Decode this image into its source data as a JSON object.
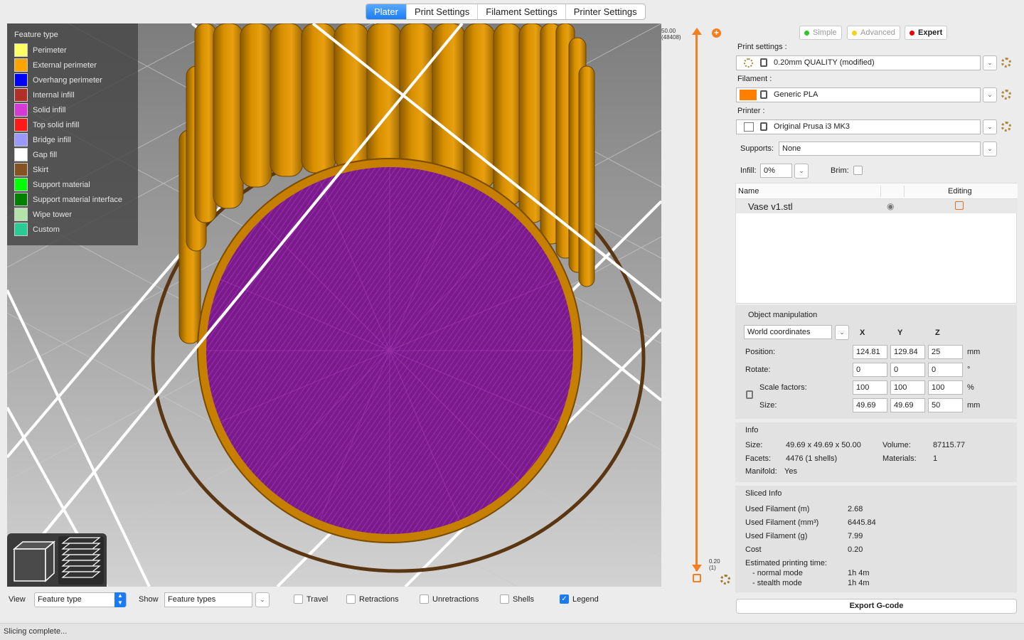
{
  "tabs": [
    "Plater",
    "Print Settings",
    "Filament Settings",
    "Printer Settings"
  ],
  "legend": {
    "title": "Feature type",
    "items": [
      {
        "label": "Perimeter",
        "color": "#ffff66"
      },
      {
        "label": "External perimeter",
        "color": "#ffa500"
      },
      {
        "label": "Overhang perimeter",
        "color": "#0000ff"
      },
      {
        "label": "Internal infill",
        "color": "#b03029"
      },
      {
        "label": "Solid infill",
        "color": "#d63ad6"
      },
      {
        "label": "Top solid infill",
        "color": "#ff1a1a"
      },
      {
        "label": "Bridge infill",
        "color": "#9999ff"
      },
      {
        "label": "Gap fill",
        "color": "#ffffff"
      },
      {
        "label": "Skirt",
        "color": "#845321"
      },
      {
        "label": "Support material",
        "color": "#00ff00"
      },
      {
        "label": "Support material interface",
        "color": "#008000"
      },
      {
        "label": "Wipe tower",
        "color": "#b3e3ab"
      },
      {
        "label": "Custom",
        "color": "#28cc94"
      }
    ]
  },
  "slider": {
    "top_value": "50.00",
    "top_count": "(48408)",
    "bottom_value": "0.20",
    "bottom_count": "(1)"
  },
  "bottom": {
    "view_label": "View",
    "view_value": "Feature type",
    "show_label": "Show",
    "show_value": "Feature types",
    "checks": [
      {
        "label": "Travel",
        "checked": false
      },
      {
        "label": "Retractions",
        "checked": false
      },
      {
        "label": "Unretractions",
        "checked": false
      },
      {
        "label": "Shells",
        "checked": false
      },
      {
        "label": "Legend",
        "checked": true
      }
    ]
  },
  "modes": {
    "simple": "Simple",
    "advanced": "Advanced",
    "expert": "Expert"
  },
  "presets": {
    "print_label": "Print settings :",
    "print_value": "0.20mm QUALITY (modified)",
    "filament_label": "Filament :",
    "filament_value": "Generic PLA",
    "filament_color": "#ff7f00",
    "printer_label": "Printer :",
    "printer_value": "Original Prusa i3 MK3",
    "supports_label": "Supports:",
    "supports_value": "None",
    "infill_label": "Infill:",
    "infill_value": "0%",
    "brim_label": "Brim:"
  },
  "objects": {
    "col_name": "Name",
    "col_editing": "Editing",
    "rows": [
      {
        "name": "Vase v1.stl"
      }
    ]
  },
  "manip": {
    "title": "Object manipulation",
    "coords": "World coordinates",
    "x": "X",
    "y": "Y",
    "z": "Z",
    "rows": [
      {
        "label": "Position:",
        "x": "124.81",
        "y": "129.84",
        "z": "25",
        "unit": "mm"
      },
      {
        "label": "Rotate:",
        "x": "0",
        "y": "0",
        "z": "0",
        "unit": "°"
      },
      {
        "label": "Scale factors:",
        "x": "100",
        "y": "100",
        "z": "100",
        "unit": "%"
      },
      {
        "label": "Size:",
        "x": "49.69",
        "y": "49.69",
        "z": "50",
        "unit": "mm"
      }
    ]
  },
  "info": {
    "title": "Info",
    "size_label": "Size:",
    "size": "49.69 x 49.69 x 50.00",
    "volume_label": "Volume:",
    "volume": "87115.77",
    "facets_label": "Facets:",
    "facets": "4476 (1 shells)",
    "materials_label": "Materials:",
    "materials": "1",
    "manifold_label": "Manifold:",
    "manifold": "Yes"
  },
  "sliced": {
    "title": "Sliced Info",
    "rows": [
      {
        "label": "Used Filament (m)",
        "value": "2.68"
      },
      {
        "label": "Used Filament (mm³)",
        "value": "6445.84"
      },
      {
        "label": "Used Filament (g)",
        "value": "7.99"
      },
      {
        "label": "Cost",
        "value": "0.20"
      }
    ],
    "time_label": "Estimated printing time:",
    "normal_label": "- normal mode",
    "normal": "1h 4m",
    "stealth_label": "- stealth mode",
    "stealth": "1h 4m"
  },
  "export_label": "Export G-code",
  "status": "Slicing complete..."
}
